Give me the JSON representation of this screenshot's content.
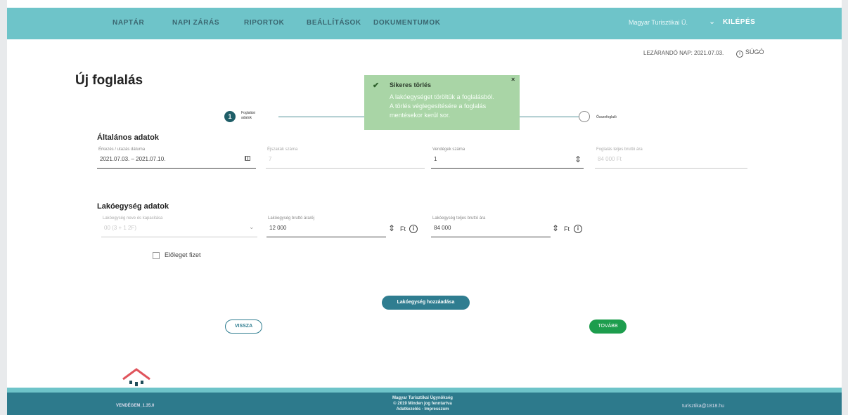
{
  "nav": {
    "items": [
      "NAPTÁR",
      "NAPI ZÁRÁS",
      "RIPORTOK",
      "BEÁLLÍTÁSOK",
      "DOKUMENTUMOK"
    ],
    "user": "Magyar Turisztikai Ü.",
    "logout": "KILÉPÉS"
  },
  "header": {
    "closing_date": "LEZÁRANDÓ NAP: 2021.07.03.",
    "help": "SÚGÓ"
  },
  "page": {
    "title": "Új foglalás"
  },
  "stepper": {
    "step1_number": "1",
    "step1_label_line1": "Foglalási",
    "step1_label_line2": "adatok",
    "step2_label": "Összefoglaló"
  },
  "general": {
    "title": "Általános adatok",
    "dates_label": "Érkezés / utazás dátuma",
    "dates_value": "2021.07.03. – 2021.07.10.",
    "nights_label": "Éjszakák száma",
    "nights_value": "7",
    "guests_label": "Vendégek száma",
    "guests_value": "1",
    "total_label": "Foglalás teljes bruttó ára",
    "total_value": "84 000 Ft"
  },
  "unit": {
    "title": "Lakóegység adatok",
    "name_label": "Lakóegység neve és kapacitása",
    "name_value": "00 (3 + 1 2F)",
    "price_label": "Lakóegység bruttó ára/éj",
    "price_value": "12 000",
    "full_label": "Lakóegység teljes bruttó ára",
    "full_value": "84 000",
    "currency": "Ft",
    "advance_label": "Előleget fizet"
  },
  "buttons": {
    "add_unit": "Lakóegység hozzáadása",
    "back": "VISSZA",
    "next": "TOVÁBB"
  },
  "toast": {
    "title": "Sikeres törlés",
    "close": "×",
    "line1": "A lakóegységet töröltük a foglalásból.",
    "line2": "A törlés véglegesítésére a foglalás mentésekor kerül sor."
  },
  "footer": {
    "version": "VENDÉGEM_1.35.0",
    "org": "Magyar Turisztikai Ügynökség",
    "rights": "© 2019 Minden jog fenntartva",
    "links": "Adatkezelés · Impresszum",
    "email": "turisztika@1818.hu"
  }
}
